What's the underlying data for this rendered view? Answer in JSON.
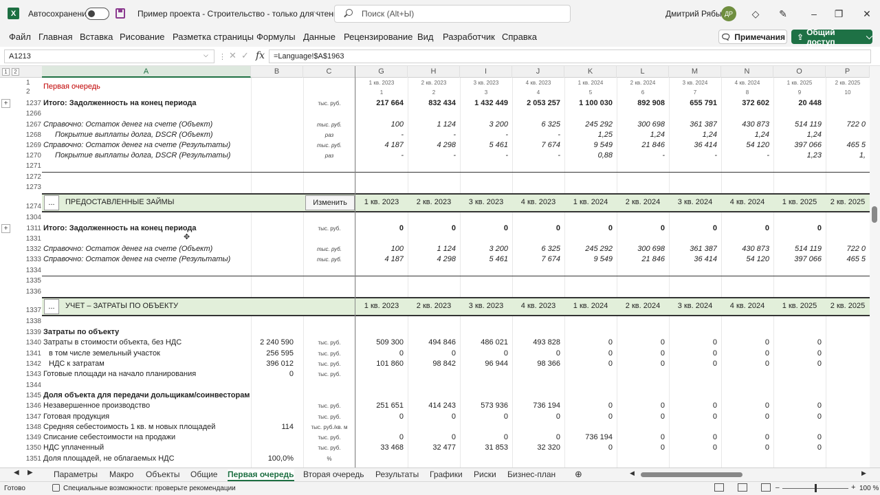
{
  "titlebar": {
    "autosave": "Автосохранение",
    "doc_title": "Пример проекта - Строительство  -  только для чтения",
    "search_placeholder": "Поиск (Alt+Ы)",
    "user_name": "Дмитрий Рябых",
    "user_initials": "ДР"
  },
  "menu": [
    "Файл",
    "Главная",
    "Вставка",
    "Рисование",
    "Разметка страницы",
    "Формулы",
    "Данные",
    "Рецензирование",
    "Вид",
    "Разработчик",
    "Справка"
  ],
  "buttons": {
    "notes": "Примечания",
    "share": "Общий доступ"
  },
  "formula": {
    "name_box": "A1213",
    "formula": "=Language!$A$1963",
    "fx": "fx"
  },
  "columns": [
    "A",
    "B",
    "C",
    "G",
    "H",
    "I",
    "J",
    "K",
    "L",
    "M",
    "N",
    "O",
    "P"
  ],
  "header_rows": {
    "r1_num": "1",
    "r2_num": "2",
    "r1_label": "Первая очередь",
    "quarters_small": [
      "1 кв. 2023",
      "2 кв. 2023",
      "3 кв. 2023",
      "4 кв. 2023",
      "1 кв. 2024",
      "2 кв. 2024",
      "3 кв. 2024",
      "4 кв. 2024",
      "1 кв. 2025",
      "2 кв. 2025"
    ],
    "indexes": [
      "1",
      "2",
      "3",
      "4",
      "5",
      "6",
      "7",
      "8",
      "9",
      "10"
    ]
  },
  "quarters": [
    "1 кв. 2023",
    "2 кв. 2023",
    "3 кв. 2023",
    "4 кв. 2023",
    "1 кв. 2024",
    "2 кв. 2024",
    "3 кв. 2024",
    "4 кв. 2024",
    "1 кв. 2025",
    "2 кв. 2025"
  ],
  "sections": {
    "loans": {
      "num": "1274",
      "label": "ПРЕДОСТАВЛЕННЫЕ ЗАЙМЫ",
      "more": "...",
      "change": "Изменить"
    },
    "costs": {
      "num": "1337",
      "label": "УЧЕТ – ЗАТРАТЫ ПО ОБЪЕКТУ",
      "more": "..."
    }
  },
  "rows": [
    {
      "num": "1237",
      "label": "Итого: Задолженность на конец периода",
      "style": "bold",
      "b": "",
      "unit": "тыс. руб.",
      "vals": [
        "217 664",
        "832 434",
        "1 432 449",
        "2 053 257",
        "1 100 030",
        "892 908",
        "655 791",
        "372 602",
        "20 448",
        ""
      ]
    },
    {
      "num": "1266",
      "label": "",
      "b": "",
      "unit": "",
      "vals": [
        "",
        "",
        "",
        "",
        "",
        "",
        "",
        "",
        "",
        ""
      ]
    },
    {
      "num": "1267",
      "label": "Справочно: Остаток денег на счете (Объект)",
      "style": "italic",
      "b": "",
      "unit": "тыс. руб.",
      "vals": [
        "100",
        "1 124",
        "3 200",
        "6 325",
        "245 292",
        "300 698",
        "361 387",
        "430 873",
        "514 119",
        "722 0"
      ]
    },
    {
      "num": "1268",
      "label": "Покрытие выплаты долга, DSCR (Объект)",
      "style": "italic-indent",
      "b": "",
      "unit": "раз",
      "vals": [
        "-",
        "-",
        "-",
        "-",
        "1,25",
        "1,24",
        "1,24",
        "1,24",
        "1,24",
        ""
      ]
    },
    {
      "num": "1269",
      "label": "Справочно: Остаток денег на счете (Результаты)",
      "style": "italic",
      "b": "",
      "unit": "тыс. руб.",
      "vals": [
        "4 187",
        "4 298",
        "5 461",
        "7 674",
        "9 549",
        "21 846",
        "36 414",
        "54 120",
        "397 066",
        "465 5"
      ]
    },
    {
      "num": "1270",
      "label": "Покрытие выплаты долга, DSCR (Результаты)",
      "style": "italic-indent",
      "b": "",
      "unit": "раз",
      "vals": [
        "-",
        "-",
        "-",
        "-",
        "0,88",
        "-",
        "-",
        "-",
        "1,23",
        "1,"
      ]
    },
    {
      "num": "1271",
      "label": "",
      "b": "",
      "unit": "",
      "vals": [
        "",
        "",
        "",
        "",
        "",
        "",
        "",
        "",
        "",
        ""
      ]
    },
    {
      "num": "1272",
      "label": "",
      "b": "",
      "unit": "",
      "vals": [
        "",
        "",
        "",
        "",
        "",
        "",
        "",
        "",
        "",
        ""
      ]
    },
    {
      "num": "1273",
      "label": "",
      "b": "",
      "unit": "",
      "vals": [
        "",
        "",
        "",
        "",
        "",
        "",
        "",
        "",
        "",
        ""
      ]
    },
    {
      "num": "1304",
      "label": "",
      "b": "",
      "unit": "",
      "vals": [
        "",
        "",
        "",
        "",
        "",
        "",
        "",
        "",
        "",
        ""
      ]
    },
    {
      "num": "1311",
      "label": "Итого: Задолженность на конец периода",
      "style": "bold",
      "b": "",
      "unit": "тыс. руб.",
      "vals": [
        "0",
        "0",
        "0",
        "0",
        "0",
        "0",
        "0",
        "0",
        "0",
        ""
      ]
    },
    {
      "num": "1331",
      "label": "",
      "b": "",
      "unit": "",
      "vals": [
        "",
        "",
        "",
        "",
        "",
        "",
        "",
        "",
        "",
        ""
      ]
    },
    {
      "num": "1332",
      "label": "Справочно: Остаток денег на счете (Объект)",
      "style": "italic",
      "b": "",
      "unit": "тыс. руб.",
      "vals": [
        "100",
        "1 124",
        "3 200",
        "6 325",
        "245 292",
        "300 698",
        "361 387",
        "430 873",
        "514 119",
        "722 0"
      ]
    },
    {
      "num": "1333",
      "label": "Справочно: Остаток денег на счете (Результаты)",
      "style": "italic",
      "b": "",
      "unit": "тыс. руб.",
      "vals": [
        "4 187",
        "4 298",
        "5 461",
        "7 674",
        "9 549",
        "21 846",
        "36 414",
        "54 120",
        "397 066",
        "465 5"
      ]
    },
    {
      "num": "1334",
      "label": "",
      "b": "",
      "unit": "",
      "vals": [
        "",
        "",
        "",
        "",
        "",
        "",
        "",
        "",
        "",
        ""
      ]
    },
    {
      "num": "1335",
      "label": "",
      "b": "",
      "unit": "",
      "vals": [
        "",
        "",
        "",
        "",
        "",
        "",
        "",
        "",
        "",
        ""
      ]
    },
    {
      "num": "1336",
      "label": "",
      "b": "",
      "unit": "",
      "vals": [
        "",
        "",
        "",
        "",
        "",
        "",
        "",
        "",
        "",
        ""
      ]
    },
    {
      "num": "1338",
      "label": "",
      "b": "",
      "unit": "",
      "vals": [
        "",
        "",
        "",
        "",
        "",
        "",
        "",
        "",
        "",
        ""
      ]
    },
    {
      "num": "1339",
      "label": "Затраты по объекту",
      "style": "bold",
      "b": "",
      "unit": "",
      "vals": [
        "",
        "",
        "",
        "",
        "",
        "",
        "",
        "",
        "",
        ""
      ]
    },
    {
      "num": "1340",
      "label": "Затраты в стоимости объекта, без НДС",
      "b": "2 240 590",
      "unit": "тыс. руб.",
      "vals": [
        "509 300",
        "494 846",
        "486 021",
        "493 828",
        "0",
        "0",
        "0",
        "0",
        "0",
        ""
      ]
    },
    {
      "num": "1341",
      "label": "в том числе земельный участок",
      "style": "indent",
      "b": "256 595",
      "unit": "тыс. руб.",
      "vals": [
        "0",
        "0",
        "0",
        "0",
        "0",
        "0",
        "0",
        "0",
        "0",
        ""
      ]
    },
    {
      "num": "1342",
      "label": "НДС к затратам",
      "style": "indent",
      "b": "396 012",
      "unit": "тыс. руб.",
      "vals": [
        "101 860",
        "98 842",
        "96 944",
        "98 366",
        "0",
        "0",
        "0",
        "0",
        "0",
        ""
      ]
    },
    {
      "num": "1343",
      "label": "Готовые площади на начало планирования",
      "b": "0",
      "unit": "тыс. руб.",
      "vals": [
        "",
        "",
        "",
        "",
        "",
        "",
        "",
        "",
        "",
        ""
      ]
    },
    {
      "num": "1344",
      "label": "",
      "b": "",
      "unit": "",
      "vals": [
        "",
        "",
        "",
        "",
        "",
        "",
        "",
        "",
        "",
        ""
      ]
    },
    {
      "num": "1345",
      "label": "Доля объекта для передачи дольщикам/соинвесторам",
      "style": "bold",
      "b": "",
      "unit": "",
      "vals": [
        "",
        "",
        "",
        "",
        "",
        "",
        "",
        "",
        "",
        ""
      ]
    },
    {
      "num": "1346",
      "label": "Незавершенное производство",
      "b": "",
      "unit": "тыс. руб.",
      "vals": [
        "251 651",
        "414 243",
        "573 936",
        "736 194",
        "0",
        "0",
        "0",
        "0",
        "0",
        ""
      ]
    },
    {
      "num": "1347",
      "label": "Готовая продукция",
      "b": "",
      "unit": "тыс. руб.",
      "vals": [
        "0",
        "0",
        "0",
        "0",
        "0",
        "0",
        "0",
        "0",
        "0",
        ""
      ]
    },
    {
      "num": "1348",
      "label": "Средняя себестоимость 1 кв. м новых площадей",
      "b": "114",
      "unit": "тыс. руб./кв. м",
      "vals": [
        "",
        "",
        "",
        "",
        "",
        "",
        "",
        "",
        "",
        ""
      ]
    },
    {
      "num": "1349",
      "label": "Списание себестоимости на продажи",
      "b": "",
      "unit": "тыс. руб.",
      "vals": [
        "0",
        "0",
        "0",
        "0",
        "736 194",
        "0",
        "0",
        "0",
        "0",
        ""
      ]
    },
    {
      "num": "1350",
      "label": "НДС уплаченный",
      "b": "",
      "unit": "тыс. руб.",
      "vals": [
        "33 468",
        "32 477",
        "31 853",
        "32 320",
        "0",
        "0",
        "0",
        "0",
        "0",
        ""
      ]
    },
    {
      "num": "1351",
      "label": "Доля площадей, не облагаемых НДС",
      "b": "100,0%",
      "unit": "%",
      "vals": [
        "",
        "",
        "",
        "",
        "",
        "",
        "",
        "",
        "",
        ""
      ]
    }
  ],
  "sheet_tabs": [
    "Параметры",
    "Макро",
    "Объекты",
    "Общие",
    "Первая очередь",
    "Вторая очередь",
    "Результаты",
    "Графики",
    "Риски",
    "Бизнес-план"
  ],
  "active_tab": "Первая очередь",
  "status": {
    "ready": "Готово",
    "accessibility": "Специальные возможности: проверьте рекомендации",
    "zoom": "100 %"
  },
  "outline_levels": [
    "1",
    "2"
  ]
}
